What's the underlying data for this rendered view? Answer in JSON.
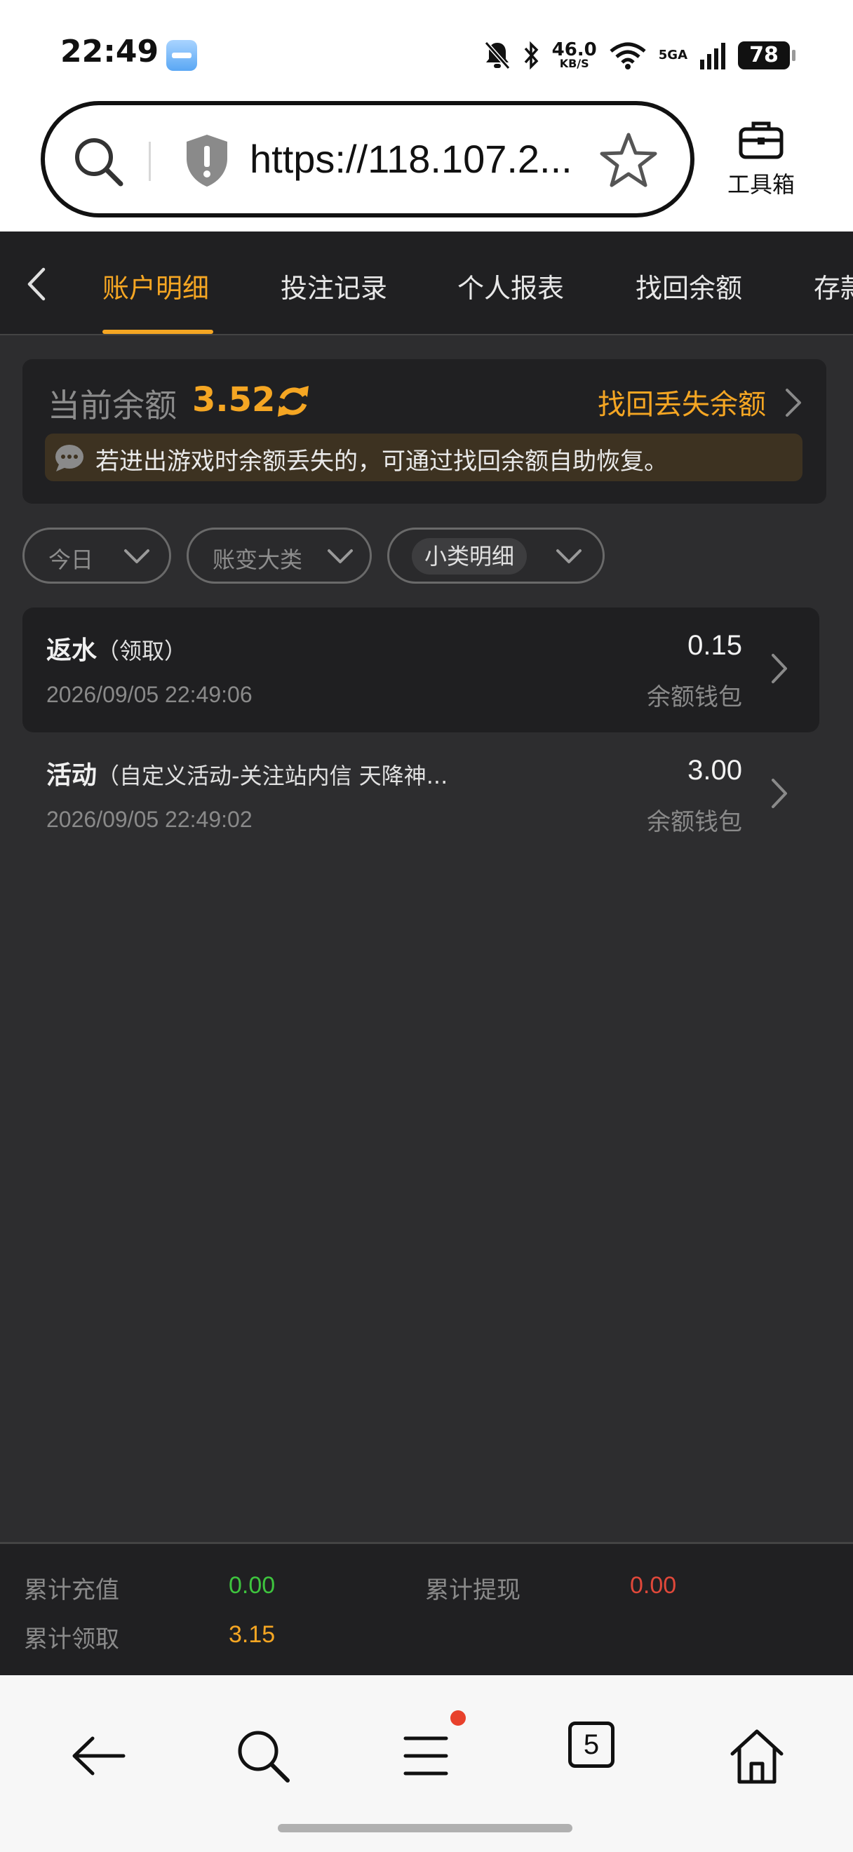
{
  "status_bar": {
    "time": "22:49",
    "net_speed": "46.0",
    "net_unit": "KB/S",
    "network_type": "5GA",
    "battery": "78"
  },
  "browser": {
    "url": "https://118.107.2...",
    "toolbox_label": "工具箱",
    "tabs_count": "5"
  },
  "tabs": [
    {
      "label": "账户明细",
      "active": true
    },
    {
      "label": "投注记录",
      "active": false
    },
    {
      "label": "个人报表",
      "active": false
    },
    {
      "label": "找回余额",
      "active": false
    },
    {
      "label": "存款",
      "active": false
    }
  ],
  "balance": {
    "label": "当前余额",
    "value": "3.52",
    "recover_link": "找回丢失余额",
    "notice": "若进出游戏时余额丢失的，可通过找回余额自助恢复。"
  },
  "filters": [
    {
      "label": "今日"
    },
    {
      "label": "账变大类"
    },
    {
      "label": "小类明细"
    }
  ],
  "records": [
    {
      "type": "返水",
      "detail": "（领取）",
      "time": "2026/09/05 22:49:06",
      "amount": "0.15",
      "wallet": "余额钱包"
    },
    {
      "type": "活动",
      "detail": "（自定义活动-关注站内信 天降神...",
      "time": "2026/09/05 22:49:02",
      "amount": "3.00",
      "wallet": "余额钱包"
    }
  ],
  "summary": {
    "recharge_label": "累计充值",
    "recharge_value": "0.00",
    "withdraw_label": "累计提现",
    "withdraw_value": "0.00",
    "claim_label": "累计领取",
    "claim_value": "3.15"
  },
  "colors": {
    "accent": "#f5a623",
    "recharge": "#3ec43e",
    "withdraw": "#e0483a",
    "background": "#2d2d2f"
  }
}
